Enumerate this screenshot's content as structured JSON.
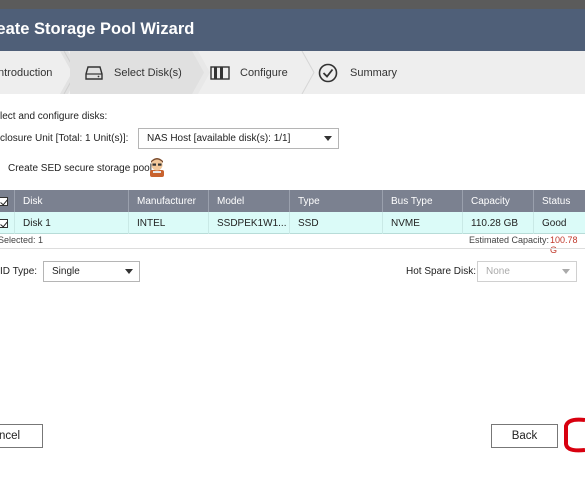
{
  "window": {
    "title": "reate Storage Pool Wizard"
  },
  "steps": [
    {
      "label": "ntroduction",
      "icon": "none"
    },
    {
      "label": "Select Disk(s)",
      "icon": "disk-drive-icon"
    },
    {
      "label": "Configure",
      "icon": "configure-bars-icon"
    },
    {
      "label": "Summary",
      "icon": "checkmark-circle-icon"
    }
  ],
  "form": {
    "heading": "lect and configure disks:",
    "enclosure_label": "closure Unit [Total: 1 Unit(s)]:",
    "enclosure_value": "NAS Host [available disk(s): 1/1]",
    "sed_label": "Create SED secure storage pool"
  },
  "table": {
    "columns": [
      "Disk",
      "Manufacturer",
      "Model",
      "Type",
      "Bus Type",
      "Capacity",
      "Status"
    ],
    "rows": [
      {
        "disk": "Disk 1",
        "manufacturer": "INTEL",
        "model": "SSDPEK1W1...",
        "type": "SSD",
        "bus_type": "NVME",
        "capacity": "110.28 GB",
        "status": "Good"
      }
    ],
    "selected_text": "Selected: 1",
    "estimated_label": "Estimated Capacity:",
    "estimated_value": "100.78 G"
  },
  "raid": {
    "label": "ID Type:",
    "value": "Single",
    "hot_spare_label": "Hot Spare Disk:",
    "hot_spare_value": "None"
  },
  "buttons": {
    "cancel": "ncel",
    "back": "Back"
  },
  "colors": {
    "titlebar": "#4f5f78",
    "table_header": "#7b8190",
    "row_highlight": "#dbfbf8",
    "estimated_value": "#c0392b",
    "annotation": "#d8000f"
  }
}
